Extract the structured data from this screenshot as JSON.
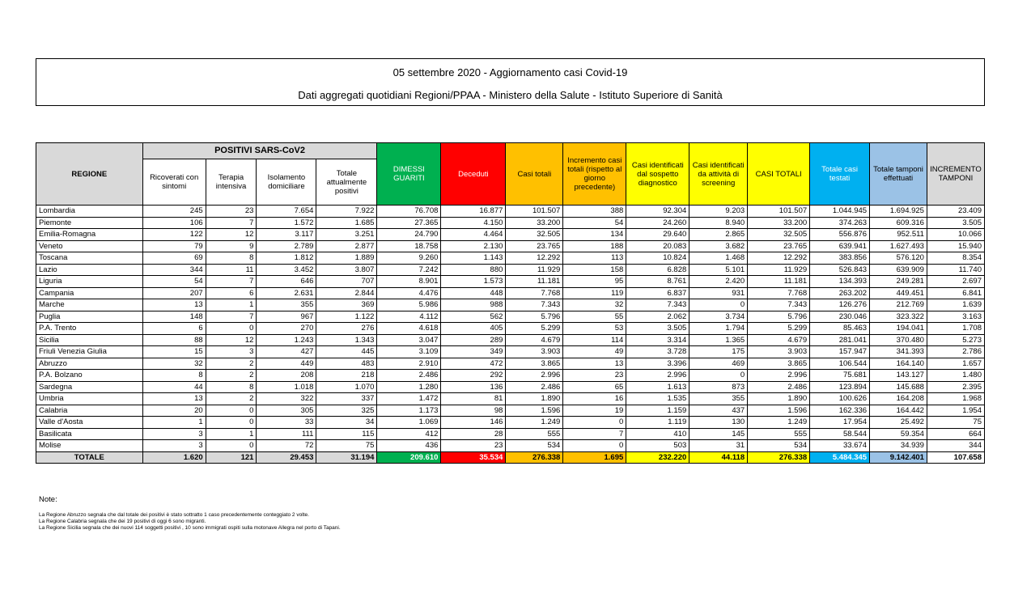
{
  "header": {
    "title": "05 settembre 2020 - Aggiornamento casi Covid-19",
    "subtitle": "Dati aggregati quotidiani Regioni/PPAA - Ministero della Salute - Istituto Superiore di Sanità"
  },
  "table": {
    "group_header": "POSITIVI SARS-CoV2",
    "columns": {
      "regione": "REGIONE",
      "ricoverati": "Ricoverati con sintomi",
      "terapia": "Terapia intensiva",
      "isolamento": "Isolamento domiciliare",
      "totale_positivi": "Totale attualmente positivi",
      "dimessi": "DIMESSI GUARITI",
      "deceduti": "Deceduti",
      "casi_totali": "Casi totali",
      "incremento": "Incremento casi totali (rispetto al giorno precedente)",
      "sospetto": "Casi identificati dal sospetto diagnostico",
      "screening": "Casi identificati da attività di screening",
      "casi_totali_caps": "CASI TOTALI",
      "testati": "Totale casi testati",
      "tamponi": "Totale tamponi effettuati",
      "incremento_tamponi": "INCREMENTO TAMPONI"
    },
    "rows": [
      [
        "Lombardia",
        "245",
        "23",
        "7.654",
        "7.922",
        "76.708",
        "16.877",
        "101.507",
        "388",
        "92.304",
        "9.203",
        "101.507",
        "1.044.945",
        "1.694.925",
        "23.409"
      ],
      [
        "Piemonte",
        "106",
        "7",
        "1.572",
        "1.685",
        "27.365",
        "4.150",
        "33.200",
        "54",
        "24.260",
        "8.940",
        "33.200",
        "374.263",
        "609.316",
        "3.505"
      ],
      [
        "Emilia-Romagna",
        "122",
        "12",
        "3.117",
        "3.251",
        "24.790",
        "4.464",
        "32.505",
        "134",
        "29.640",
        "2.865",
        "32.505",
        "556.876",
        "952.511",
        "10.066"
      ],
      [
        "Veneto",
        "79",
        "9",
        "2.789",
        "2.877",
        "18.758",
        "2.130",
        "23.765",
        "188",
        "20.083",
        "3.682",
        "23.765",
        "639.941",
        "1.627.493",
        "15.940"
      ],
      [
        "Toscana",
        "69",
        "8",
        "1.812",
        "1.889",
        "9.260",
        "1.143",
        "12.292",
        "113",
        "10.824",
        "1.468",
        "12.292",
        "383.856",
        "576.120",
        "8.354"
      ],
      [
        "Lazio",
        "344",
        "11",
        "3.452",
        "3.807",
        "7.242",
        "880",
        "11.929",
        "158",
        "6.828",
        "5.101",
        "11.929",
        "526.843",
        "639.909",
        "11.740"
      ],
      [
        "Liguria",
        "54",
        "7",
        "646",
        "707",
        "8.901",
        "1.573",
        "11.181",
        "95",
        "8.761",
        "2.420",
        "11.181",
        "134.393",
        "249.281",
        "2.697"
      ],
      [
        "Campania",
        "207",
        "6",
        "2.631",
        "2.844",
        "4.476",
        "448",
        "7.768",
        "119",
        "6.837",
        "931",
        "7.768",
        "263.202",
        "449.451",
        "6.841"
      ],
      [
        "Marche",
        "13",
        "1",
        "355",
        "369",
        "5.986",
        "988",
        "7.343",
        "32",
        "7.343",
        "0",
        "7.343",
        "126.276",
        "212.769",
        "1.639"
      ],
      [
        "Puglia",
        "148",
        "7",
        "967",
        "1.122",
        "4.112",
        "562",
        "5.796",
        "55",
        "2.062",
        "3.734",
        "5.796",
        "230.046",
        "323.322",
        "3.163"
      ],
      [
        "P.A. Trento",
        "6",
        "0",
        "270",
        "276",
        "4.618",
        "405",
        "5.299",
        "53",
        "3.505",
        "1.794",
        "5.299",
        "85.463",
        "194.041",
        "1.708"
      ],
      [
        "Sicilia",
        "88",
        "12",
        "1.243",
        "1.343",
        "3.047",
        "289",
        "4.679",
        "114",
        "3.314",
        "1.365",
        "4.679",
        "281.041",
        "370.480",
        "5.273"
      ],
      [
        "Friuli Venezia Giulia",
        "15",
        "3",
        "427",
        "445",
        "3.109",
        "349",
        "3.903",
        "49",
        "3.728",
        "175",
        "3.903",
        "157.947",
        "341.393",
        "2.786"
      ],
      [
        "Abruzzo",
        "32",
        "2",
        "449",
        "483",
        "2.910",
        "472",
        "3.865",
        "13",
        "3.396",
        "469",
        "3.865",
        "106.544",
        "164.140",
        "1.657"
      ],
      [
        "P.A. Bolzano",
        "8",
        "2",
        "208",
        "218",
        "2.486",
        "292",
        "2.996",
        "23",
        "2.996",
        "0",
        "2.996",
        "75.681",
        "143.127",
        "1.480"
      ],
      [
        "Sardegna",
        "44",
        "8",
        "1.018",
        "1.070",
        "1.280",
        "136",
        "2.486",
        "65",
        "1.613",
        "873",
        "2.486",
        "123.894",
        "145.688",
        "2.395"
      ],
      [
        "Umbria",
        "13",
        "2",
        "322",
        "337",
        "1.472",
        "81",
        "1.890",
        "16",
        "1.535",
        "355",
        "1.890",
        "100.626",
        "164.208",
        "1.968"
      ],
      [
        "Calabria",
        "20",
        "0",
        "305",
        "325",
        "1.173",
        "98",
        "1.596",
        "19",
        "1.159",
        "437",
        "1.596",
        "162.336",
        "164.442",
        "1.954"
      ],
      [
        "Valle d'Aosta",
        "1",
        "0",
        "33",
        "34",
        "1.069",
        "146",
        "1.249",
        "0",
        "1.119",
        "130",
        "1.249",
        "17.954",
        "25.492",
        "75"
      ],
      [
        "Basilicata",
        "3",
        "1",
        "111",
        "115",
        "412",
        "28",
        "555",
        "7",
        "410",
        "145",
        "555",
        "58.544",
        "59.354",
        "664"
      ],
      [
        "Molise",
        "3",
        "0",
        "72",
        "75",
        "436",
        "23",
        "534",
        "0",
        "503",
        "31",
        "534",
        "33.674",
        "34.939",
        "344"
      ]
    ],
    "totals": [
      "TOTALE",
      "1.620",
      "121",
      "29.453",
      "31.194",
      "209.610",
      "35.534",
      "276.338",
      "1.695",
      "232.220",
      "44.118",
      "276.338",
      "5.484.345",
      "9.142.401",
      "107.658"
    ]
  },
  "notes": {
    "title": "Note:",
    "lines": [
      "La Regione Abruzzo segnala che  dal totale dei positivi è stato sottratto 1 caso precedentemente conteggiato 2 volte.",
      "La Regione Calabria segnala che dei 19 positivi di oggi 6 sono migranti.",
      "La Regione Sicilia segnala che dei nuovi 114 soggetti positivi , 10 sono immigrati ospiti sulla motonave Allegra nel porto di Tapani."
    ]
  }
}
